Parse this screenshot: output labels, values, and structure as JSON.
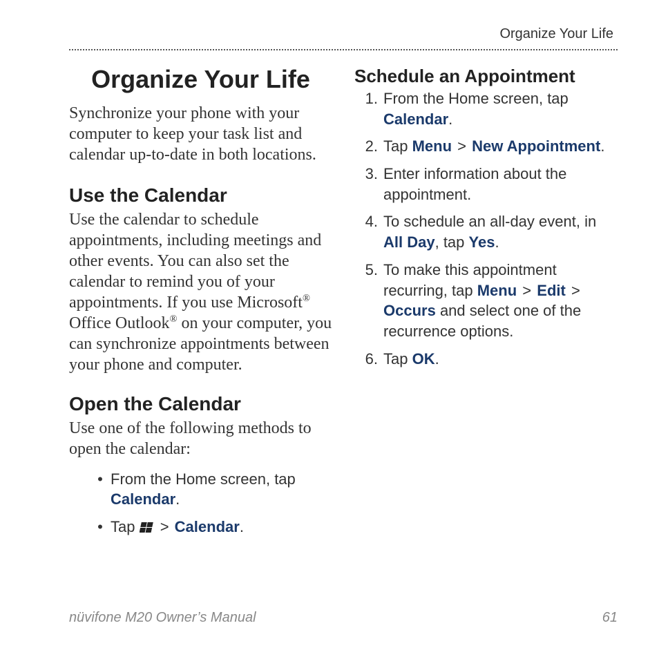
{
  "running_head": "Organize Your Life",
  "title": "Organize Your Life",
  "intro": "Synchronize your phone with your computer to keep your task list and calendar up-to-date in both locations.",
  "left": {
    "section1_heading": "Use the Calendar",
    "section1_body_pre": "Use the calendar to schedule appointments, including meetings and other events. You can also set the calendar to remind you of your appointments. If you use Microsoft",
    "section1_body_mid": " Office Outlook",
    "section1_body_post": " on your computer, you can synchronize appointments between your phone and computer.",
    "section2_heading": "Open the Calendar",
    "section2_body": "Use one of the following methods to open the calendar:",
    "bullets": {
      "b1_pre": "From the Home screen, tap ",
      "b1_ui": "Calendar",
      "b1_post": ".",
      "b2_pre": "Tap ",
      "b2_gt": " > ",
      "b2_ui": "Calendar",
      "b2_post": "."
    }
  },
  "right": {
    "heading": "Schedule an Appointment",
    "steps": {
      "n1": "1.",
      "s1_pre": "From the Home screen, tap ",
      "s1_ui": "Calendar",
      "s1_post": ".",
      "n2": "2.",
      "s2_pre": "Tap ",
      "s2_ui_a": "Menu",
      "s2_gt": " > ",
      "s2_ui_b": "New Appointment",
      "s2_post": ".",
      "n3": "3.",
      "s3": "Enter information about the appointment.",
      "n4": "4.",
      "s4_pre": "To schedule an all-day event, in ",
      "s4_ui_a": "All Day",
      "s4_mid": ", tap ",
      "s4_ui_b": "Yes",
      "s4_post": ".",
      "n5": "5.",
      "s5_pre": "To make this appointment recurring, tap ",
      "s5_ui_a": "Menu",
      "s5_gt1": " > ",
      "s5_ui_b": "Edit",
      "s5_gt2": " > ",
      "s5_ui_c": "Occurs",
      "s5_post": " and select one of the recurrence options.",
      "n6": "6.",
      "s6_pre": "Tap ",
      "s6_ui": "OK",
      "s6_post": "."
    }
  },
  "footer": {
    "left": "nüvifone M20 Owner’s Manual",
    "right": "61"
  },
  "reg_mark": "®"
}
